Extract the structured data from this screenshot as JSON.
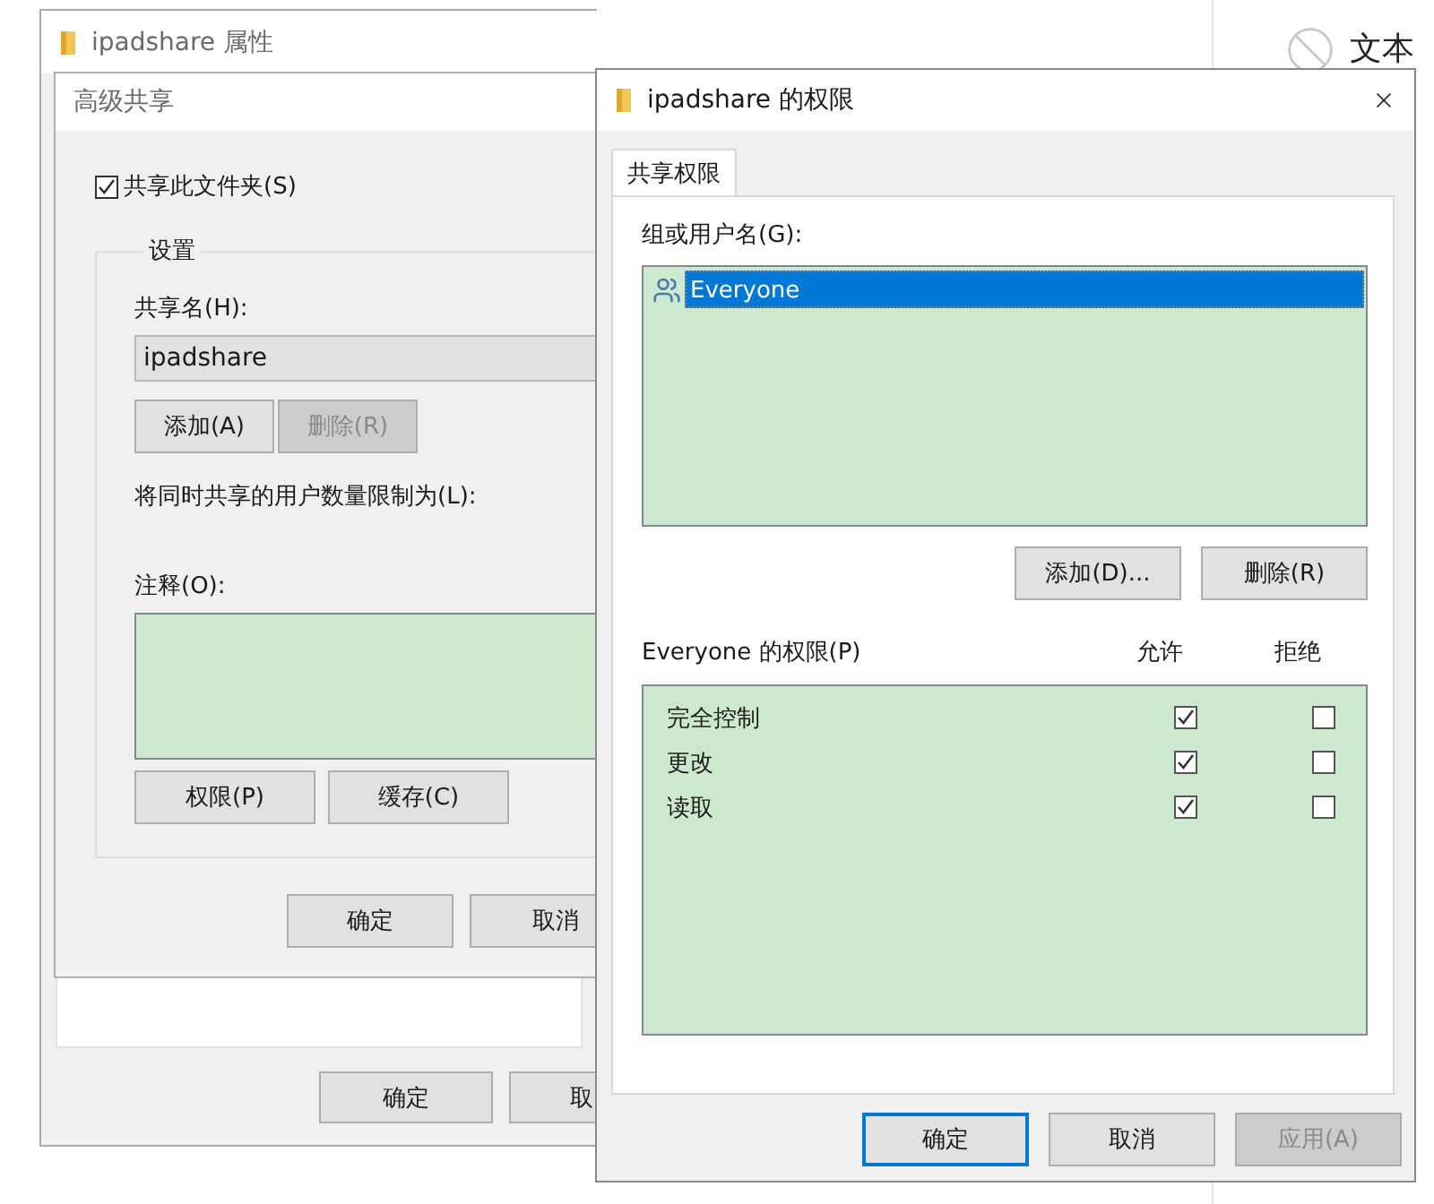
{
  "background_app": {
    "label": "文本"
  },
  "properties_window": {
    "title": "ipadshare 属性",
    "buttons": [
      {
        "label": "确定"
      },
      {
        "label": "取"
      }
    ]
  },
  "advanced_sharing": {
    "title": "高级共享",
    "share_checkbox": {
      "label": "共享此文件夹(S)",
      "checked": true
    },
    "settings_group": {
      "title": "设置",
      "share_name_label": "共享名(H):",
      "share_name_value": "ipadshare",
      "name_buttons": [
        {
          "label": "添加(A)",
          "disabled": false
        },
        {
          "label": "删除(R)",
          "disabled": true
        }
      ],
      "user_limit_label": "将同时共享的用户数量限制为(L):",
      "comment_label": "注释(O):",
      "buttons": [
        {
          "label": "权限(P)"
        },
        {
          "label": "缓存(C)"
        }
      ]
    },
    "buttons": [
      {
        "label": "确定"
      },
      {
        "label": "取消"
      }
    ]
  },
  "permissions_dialog": {
    "title": "ipadshare 的权限",
    "tabs": [
      {
        "label": "共享权限",
        "selected": true
      }
    ],
    "users_label": "组或用户名(G):",
    "users": [
      {
        "name": "Everyone",
        "selected": true
      }
    ],
    "user_buttons": [
      {
        "label": "添加(D)..."
      },
      {
        "label": "删除(R)"
      }
    ],
    "permissions_label": "Everyone 的权限(P)",
    "columns": [
      "允许",
      "拒绝"
    ],
    "permissions": [
      {
        "name": "完全控制",
        "allow": true,
        "deny": false
      },
      {
        "name": "更改",
        "allow": true,
        "deny": false
      },
      {
        "name": "读取",
        "allow": true,
        "deny": false
      }
    ],
    "buttons": [
      {
        "label": "确定",
        "default": true,
        "disabled": false
      },
      {
        "label": "取消",
        "default": false,
        "disabled": false
      },
      {
        "label": "应用(A)",
        "default": false,
        "disabled": true
      }
    ]
  }
}
